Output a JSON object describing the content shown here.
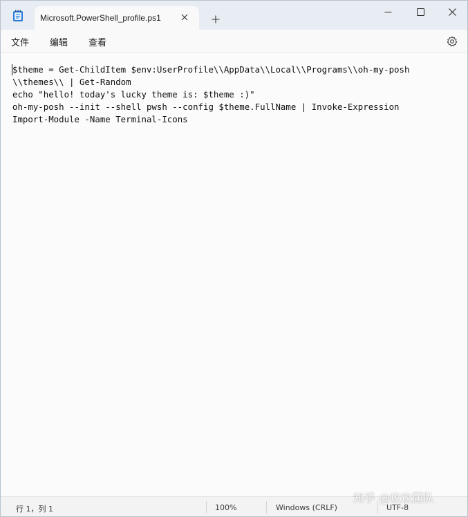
{
  "window": {
    "tab_title": "Microsoft.PowerShell_profile.ps1",
    "new_tab_glyph": "+",
    "controls": {
      "minimize": "minimize-icon",
      "maximize": "maximize-icon",
      "close": "close-icon"
    }
  },
  "menu": {
    "file": "文件",
    "edit": "编辑",
    "view": "查看",
    "settings_icon": "gear-icon"
  },
  "editor": {
    "lines": [
      "$theme = Get-ChildItem $env:UserProfile\\\\AppData\\\\Local\\\\Programs\\\\oh-my-posh",
      "\\\\themes\\\\ | Get-Random",
      "echo \"hello! today's lucky theme is: $theme :)\"",
      "oh-my-posh --init --shell pwsh --config $theme.FullName | Invoke-Expression",
      "Import-Module -Name Terminal-Icons"
    ]
  },
  "status": {
    "position": "行 1，列 1",
    "zoom": "100%",
    "line_ending": "Windows (CRLF)",
    "encoding": "UTF-8"
  },
  "watermark": "知乎 @玫玫团队"
}
